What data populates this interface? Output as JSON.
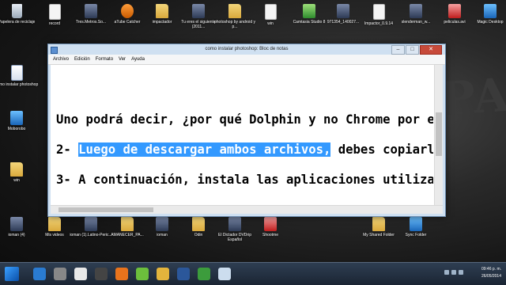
{
  "desktop": {
    "top_row": [
      {
        "label": "Papelera de reciclaje",
        "icon": "recycle-bin-icon",
        "kind": "bin"
      },
      {
        "label": "record",
        "icon": "file-icon",
        "kind": "file"
      },
      {
        "label": "Tres.Metros.So...",
        "icon": "video-file-icon",
        "kind": "video"
      },
      {
        "label": "aTube Catcher",
        "icon": "atube-app-icon",
        "kind": "app"
      },
      {
        "label": "impactador",
        "icon": "folder-icon",
        "kind": "folder"
      },
      {
        "label": "Tu eres el siguiente (2011...",
        "icon": "video-file-icon",
        "kind": "video"
      },
      {
        "label": "photoshop by android y p...",
        "icon": "folder-icon",
        "kind": "folder"
      },
      {
        "label": "win",
        "icon": "file-icon",
        "kind": "file"
      },
      {
        "label": "Camtasia Studio 8",
        "icon": "camtasia-app-icon",
        "kind": "green"
      },
      {
        "label": "971354_140027...",
        "icon": "image-file-icon",
        "kind": "video"
      },
      {
        "label": "Impactor_0.9.14",
        "icon": "file-icon",
        "kind": "file"
      },
      {
        "label": "slenderman_w...",
        "icon": "image-file-icon",
        "kind": "video"
      },
      {
        "label": "peliculas.avi",
        "icon": "pdf-file-icon",
        "kind": "pdf"
      },
      {
        "label": "Magic Desktop",
        "icon": "magic-desktop-icon",
        "kind": "blue"
      }
    ],
    "left_column": [
      {
        "label": "como instalar photoshop",
        "icon": "text-document-icon",
        "kind": "doc"
      },
      {
        "label": "Moborobo",
        "icon": "moborobo-app-icon",
        "kind": "blue"
      },
      {
        "label": "win",
        "icon": "folder-icon",
        "kind": "folder"
      }
    ],
    "bottom_row": [
      {
        "label": "ioman (4)",
        "icon": "video-file-icon",
        "kind": "video"
      },
      {
        "label": "Mis videos",
        "icon": "folder-icon",
        "kind": "folder"
      },
      {
        "label": "ioman (1).Latino-Peric...",
        "icon": "video-file-icon",
        "kind": "video"
      },
      {
        "label": "AMANECER_PA...",
        "icon": "folder-icon",
        "kind": "folder"
      },
      {
        "label": "ioman",
        "icon": "video-file-icon",
        "kind": "video"
      },
      {
        "label": "Odin",
        "icon": "folder-icon",
        "kind": "folder"
      },
      {
        "label": "El Dictador DVDrip Español",
        "icon": "video-file-icon",
        "kind": "video"
      },
      {
        "label": "Shootme",
        "icon": "shootme-app-icon",
        "kind": "pdf"
      },
      {
        "label": "My Shared Folder",
        "icon": "shared-folder-icon",
        "kind": "folder"
      },
      {
        "label": "Sync Folder",
        "icon": "sync-folder-icon",
        "kind": "blue"
      }
    ],
    "wallpaper_text": "YPA"
  },
  "notepad": {
    "title": "como instalar photoshop: Bloc de notas",
    "menu": [
      "Archivo",
      "Edición",
      "Formato",
      "Ver",
      "Ayuda"
    ],
    "lines": [
      {
        "text": "Uno podrá decir, ¿por qué Dolphin y no Chrome por e"
      },
      {
        "prefix": "2- ",
        "selected": "Luego de descargar ambos archivos,",
        "rest": " debes copiarl"
      },
      {
        "text": "3- A continuación, instala las aplicaciones utiliza"
      }
    ]
  },
  "taskbar": {
    "time": "09:46 p. m.",
    "date": "26/05/2014",
    "pinned": [
      "hp-icon",
      "media-player-icon",
      "chrome-icon",
      "winamp-icon",
      "firefox-icon",
      "utorrent-icon",
      "explorer-icon",
      "word-icon",
      "camtasia-icon",
      "notepad-icon"
    ]
  }
}
